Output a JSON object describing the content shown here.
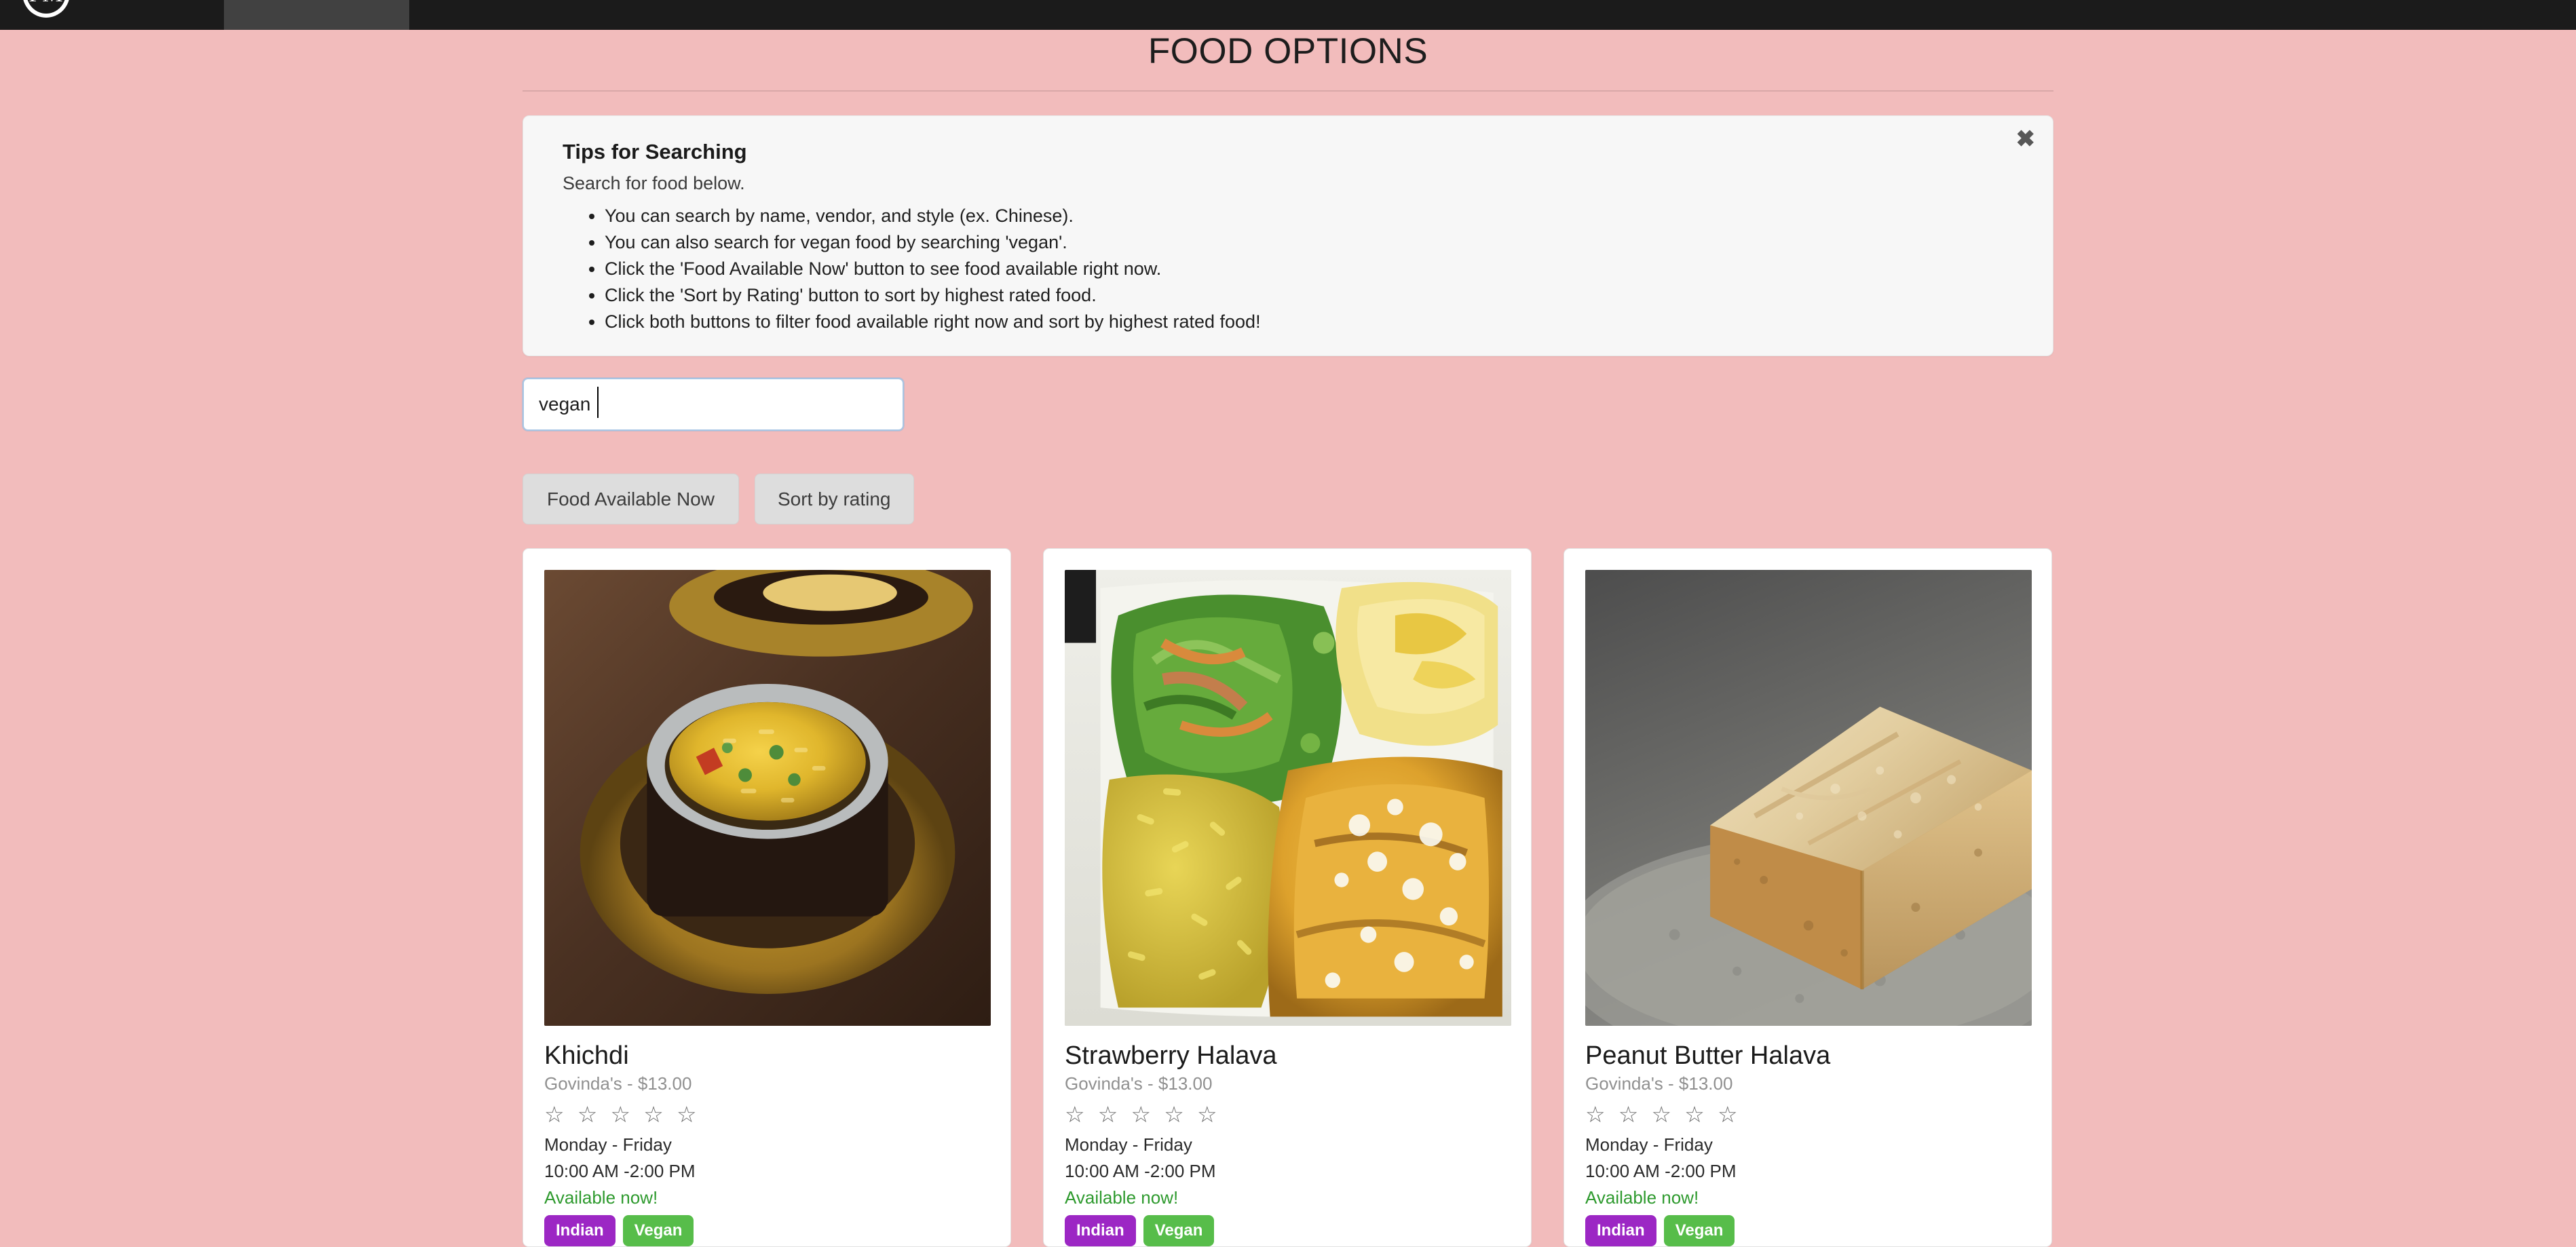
{
  "navbar": {
    "logo_text": "PM",
    "active_tab": ""
  },
  "header": {
    "title": "FOOD OPTIONS"
  },
  "alert": {
    "heading": "Tips for Searching",
    "subtitle": "Search for food below.",
    "close_label": "✖",
    "tips": [
      "You can search by name, vendor, and style (ex. Chinese).",
      "You can also search for vegan food by searching 'vegan'.",
      "Click the 'Food Available Now' button to see food available right now.",
      "Click the 'Sort by Rating' button to sort by highest rated food.",
      "Click both buttons to filter food available right now and sort by highest rated food!"
    ]
  },
  "search": {
    "value": "vegan",
    "placeholder": ""
  },
  "filters": {
    "available_now_label": "Food Available Now",
    "sort_by_rating_label": "Sort by rating"
  },
  "colors": {
    "page_background": "#f2bcbc",
    "navbar": "#1b1b1b",
    "alert_background": "#f7f7f7",
    "tag_indian": "#9c27c4",
    "tag_vegan": "#57bd4a",
    "available_text": "#2e9a2e",
    "button_background": "#dddddd",
    "input_border": "#a8c6e4"
  },
  "cards": [
    {
      "name": "Khichdi",
      "vendor_price": "Govinda's -  $13.00",
      "stars": "☆ ☆ ☆ ☆ ☆",
      "rating": 0,
      "days": "Monday - Friday",
      "hours": "10:00 AM -2:00 PM",
      "availability": "Available now!",
      "tags": [
        "Indian",
        "Vegan"
      ],
      "image_alt": "khichdi-photo"
    },
    {
      "name": "Strawberry Halava",
      "vendor_price": "Govinda's -  $13.00",
      "stars": "☆ ☆ ☆ ☆ ☆",
      "rating": 0,
      "days": "Monday - Friday",
      "hours": "10:00 AM -2:00 PM",
      "availability": "Available now!",
      "tags": [
        "Indian",
        "Vegan"
      ],
      "image_alt": "strawberry-halava-photo"
    },
    {
      "name": "Peanut Butter Halava",
      "vendor_price": "Govinda's -  $13.00",
      "stars": "☆ ☆ ☆ ☆ ☆",
      "rating": 0,
      "days": "Monday - Friday",
      "hours": "10:00 AM -2:00 PM",
      "availability": "Available now!",
      "tags": [
        "Indian",
        "Vegan"
      ],
      "image_alt": "peanut-butter-halava-photo"
    }
  ]
}
